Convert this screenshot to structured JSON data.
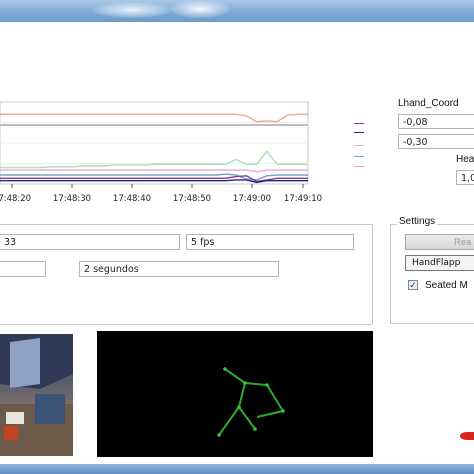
{
  "colors": {
    "series": [
      "#f0a98a",
      "#a7a7a7",
      "#9fe3b7",
      "#e7a8d3",
      "#7aa0d6",
      "#8a3a8e",
      "#1e2a7a"
    ]
  },
  "chart_data": {
    "type": "line",
    "x_ticks": [
      "17:48:20",
      "17:48:30",
      "17:48:40",
      "17:48:50",
      "17:49:00",
      "17:49:10"
    ],
    "series": [
      {
        "color": "#f0a98a",
        "values": [
          0.85,
          0.85,
          0.85,
          0.85,
          0.85,
          0.85,
          0.85,
          0.85,
          0.85,
          0.85,
          0.85,
          0.85,
          0.85,
          0.85,
          0.85,
          0.85,
          0.85,
          0.85,
          0.85,
          0.85,
          0.85,
          0.85,
          0.85,
          0.85,
          0.83,
          0.76,
          0.77,
          0.76,
          0.84,
          0.85,
          0.85
        ]
      },
      {
        "color": "#a7a7a7",
        "values": [
          0.72,
          0.72,
          0.72,
          0.72,
          0.72,
          0.72,
          0.72,
          0.72,
          0.72,
          0.72,
          0.72,
          0.72,
          0.72,
          0.72,
          0.72,
          0.72,
          0.72,
          0.72,
          0.72,
          0.72,
          0.72,
          0.72,
          0.72,
          0.72,
          0.72,
          0.72,
          0.72,
          0.72,
          0.72,
          0.72,
          0.72
        ]
      },
      {
        "color": "#9fe3b7",
        "values": [
          0.2,
          0.2,
          0.2,
          0.2,
          0.2,
          0.21,
          0.21,
          0.21,
          0.22,
          0.22,
          0.22,
          0.23,
          0.23,
          0.23,
          0.23,
          0.24,
          0.24,
          0.24,
          0.24,
          0.24,
          0.24,
          0.24,
          0.24,
          0.3,
          0.24,
          0.24,
          0.4,
          0.24,
          0.24,
          0.24,
          0.24
        ]
      },
      {
        "color": "#e7a8d3",
        "values": [
          0.17,
          0.17,
          0.17,
          0.17,
          0.17,
          0.17,
          0.17,
          0.17,
          0.17,
          0.17,
          0.17,
          0.17,
          0.17,
          0.17,
          0.17,
          0.17,
          0.17,
          0.17,
          0.17,
          0.17,
          0.17,
          0.17,
          0.17,
          0.17,
          0.17,
          0.15,
          0.17,
          0.17,
          0.17,
          0.17,
          0.17
        ]
      },
      {
        "color": "#7aa0d6",
        "values": [
          0.11,
          0.11,
          0.11,
          0.11,
          0.11,
          0.11,
          0.11,
          0.11,
          0.11,
          0.11,
          0.11,
          0.11,
          0.11,
          0.11,
          0.11,
          0.11,
          0.11,
          0.11,
          0.11,
          0.11,
          0.11,
          0.11,
          0.12,
          0.11,
          0.06,
          0.05,
          0.1,
          0.11,
          0.11,
          0.11,
          0.11
        ]
      },
      {
        "color": "#8a3a8e",
        "values": [
          0.07,
          0.07,
          0.07,
          0.07,
          0.07,
          0.07,
          0.07,
          0.07,
          0.07,
          0.07,
          0.07,
          0.07,
          0.07,
          0.07,
          0.07,
          0.07,
          0.07,
          0.07,
          0.07,
          0.07,
          0.07,
          0.07,
          0.07,
          0.09,
          0.1,
          0.03,
          0.05,
          0.07,
          0.07,
          0.07,
          0.07
        ]
      },
      {
        "color": "#1e2a7a",
        "values": [
          0.04,
          0.04,
          0.04,
          0.04,
          0.04,
          0.04,
          0.04,
          0.04,
          0.04,
          0.04,
          0.04,
          0.04,
          0.04,
          0.04,
          0.04,
          0.04,
          0.04,
          0.04,
          0.04,
          0.04,
          0.04,
          0.04,
          0.04,
          0.05,
          0.05,
          0.02,
          0.04,
          0.04,
          0.04,
          0.04,
          0.04
        ]
      }
    ]
  },
  "right_panel": {
    "coord_label": "Lhand_Coord",
    "coord_values": [
      "-0,08",
      "-0,30"
    ],
    "head_label": "Hea",
    "head_value": "1,0"
  },
  "controls": {
    "count_value": "33",
    "fps_value": "5 fps",
    "duration_value": "2 segundos"
  },
  "settings": {
    "title": "Settings",
    "button_label": "Rea",
    "gesture_selected": "HandFlapp",
    "seated_label": "Seated M",
    "seated_checked": "✓"
  }
}
